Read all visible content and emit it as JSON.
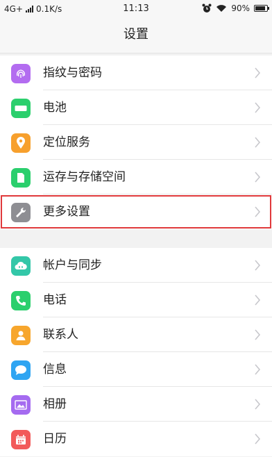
{
  "status_bar": {
    "network": "4G+",
    "speed": "0.1K/s",
    "time": "11:13",
    "battery": "90%",
    "battery_level": 0.9
  },
  "header": {
    "title": "设置"
  },
  "groups": [
    {
      "items": [
        {
          "label": "指纹与密码",
          "icon": "fingerprint-icon",
          "color": "#b36cf0"
        },
        {
          "label": "电池",
          "icon": "battery-icon",
          "color": "#2bcf6d"
        },
        {
          "label": "定位服务",
          "icon": "location-icon",
          "color": "#f7a02d"
        },
        {
          "label": "运存与存储空间",
          "icon": "storage-icon",
          "color": "#2bcf6d"
        },
        {
          "label": "更多设置",
          "icon": "wrench-icon",
          "color": "#8e8e93",
          "highlighted": true
        }
      ]
    },
    {
      "items": [
        {
          "label": "帐户与同步",
          "icon": "cloud-sync-icon",
          "color": "#33c7a8"
        },
        {
          "label": "电话",
          "icon": "phone-icon",
          "color": "#2bcf6d"
        },
        {
          "label": "联系人",
          "icon": "contact-icon",
          "color": "#f7a62d"
        },
        {
          "label": "信息",
          "icon": "message-icon",
          "color": "#2fa5f2"
        },
        {
          "label": "相册",
          "icon": "album-icon",
          "color": "#a56bf0"
        },
        {
          "label": "日历",
          "icon": "calendar-icon",
          "color": "#f25a5a"
        }
      ]
    }
  ]
}
